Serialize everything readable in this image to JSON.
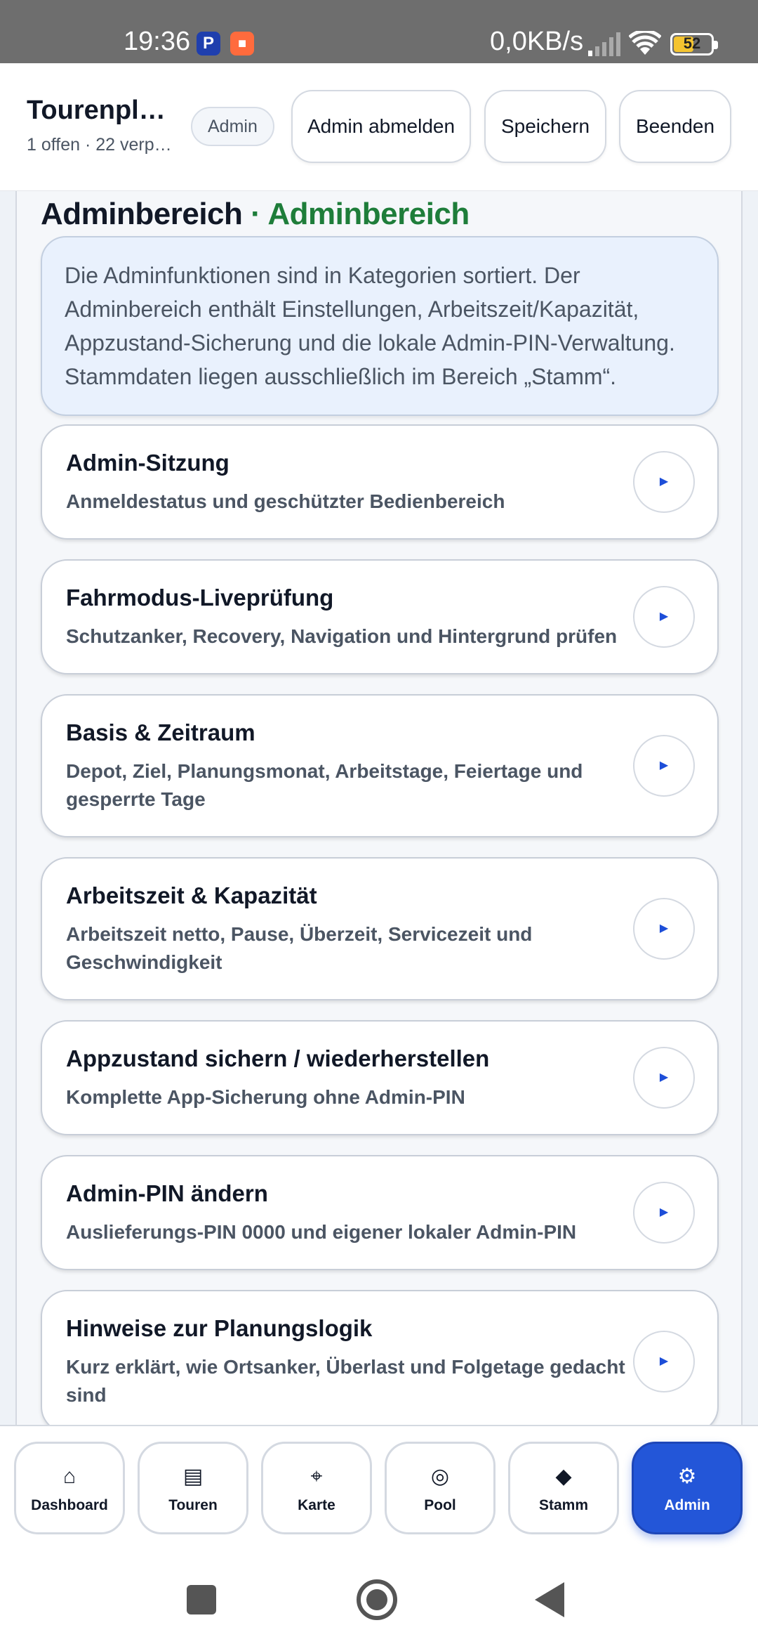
{
  "status": {
    "time": "19:36",
    "app1_icon": "paypal-icon",
    "app1_glyph": "P",
    "app2_icon": "camera-icon",
    "app2_glyph": "■",
    "net_speed": "0,0KB/s",
    "battery": "52"
  },
  "header": {
    "title": "Tourenpl…",
    "subtitle": "1 offen · 22 verp…",
    "role_chip": "Admin",
    "logout_label": "Admin abmelden",
    "save_label": "Speichern",
    "exit_label": "Beenden"
  },
  "section": {
    "title": "Adminbereich",
    "title_accent": "· Adminbereich",
    "accent_color": "#1e7d3a",
    "info": "Die Adminfunktionen sind in Kategorien sortiert. Der Adminbereich enthält Einstellungen, Arbeitszeit/Kapazität, Appzustand-Sicherung und die lokale Admin-PIN-Verwaltung. Stammdaten liegen ausschließlich im Bereich „Stamm“."
  },
  "cards": [
    {
      "title": "Admin-Sitzung",
      "desc": "Anmeldestatus und geschützter Bedienbereich"
    },
    {
      "title": "Fahrmodus-Liveprüfung",
      "desc": "Schutzanker, Recovery, Navigation und Hintergrund prüfen"
    },
    {
      "title": "Basis & Zeitraum",
      "desc": "Depot, Ziel, Planungsmonat, Arbeitstage, Feiertage und gesperrte Tage"
    },
    {
      "title": "Arbeitszeit & Kapazität",
      "desc": "Arbeitszeit netto, Pause, Überzeit, Servicezeit und Geschwindigkeit"
    },
    {
      "title": "Appzustand sichern / wiederherstellen",
      "desc": "Komplette App-Sicherung ohne Admin-PIN"
    },
    {
      "title": "Admin-PIN ändern",
      "desc": "Auslieferungs-PIN 0000 und eigener lokaler Admin-PIN"
    },
    {
      "title": "Hinweise zur Planungslogik",
      "desc": "Kurz erklärt, wie Ortsanker, Überlast und Folgetage gedacht sind"
    }
  ],
  "card_arrow_glyph": "▶",
  "nav": [
    {
      "label": "Dashboard",
      "icon": "home-icon",
      "glyph": "⌂"
    },
    {
      "label": "Touren",
      "icon": "list-icon",
      "glyph": "▤"
    },
    {
      "label": "Karte",
      "icon": "crosshair-icon",
      "glyph": "⌖"
    },
    {
      "label": "Pool",
      "icon": "target-icon",
      "glyph": "◎"
    },
    {
      "label": "Stamm",
      "icon": "diamond-icon",
      "glyph": "◆"
    },
    {
      "label": "Admin",
      "icon": "gear-icon",
      "glyph": "⚙"
    }
  ],
  "active_nav": "Admin",
  "colors": {
    "primary": "#2356d8",
    "accent_green": "#1e7d3a"
  }
}
